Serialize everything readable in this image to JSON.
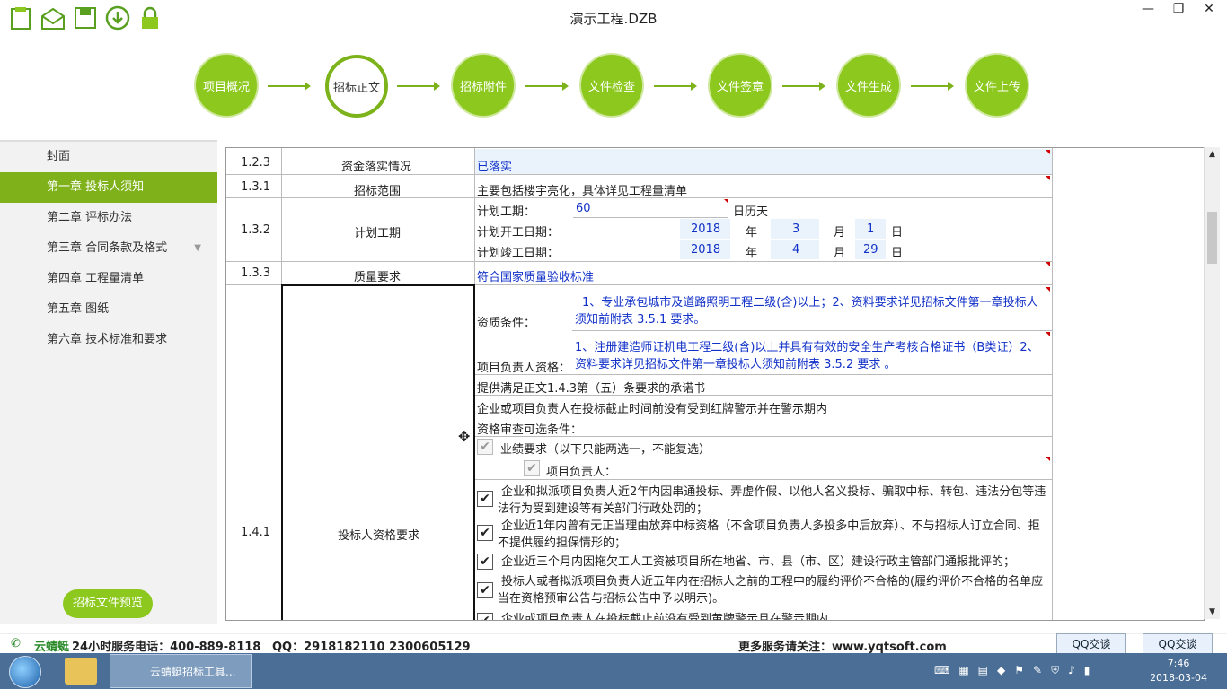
{
  "window": {
    "title": "演示工程.DZB"
  },
  "steps": [
    "项目概况",
    "招标正文",
    "招标附件",
    "文件检查",
    "文件签章",
    "文件生成",
    "文件上传"
  ],
  "sidebar": {
    "items": [
      "封面",
      "第一章 投标人须知",
      "第二章 评标办法",
      "第三章 合同条款及格式",
      "第四章 工程量清单",
      "第五章 图纸",
      "第六章 技术标准和要求"
    ],
    "preview_button": "招标文件预览"
  },
  "table": {
    "r123": {
      "num": "1.2.3",
      "name": "资金落实情况",
      "value": "已落实"
    },
    "r131": {
      "num": "1.3.1",
      "name": "招标范围",
      "value": "主要包括楼宇亮化，具体详见工程量清单"
    },
    "r132": {
      "num": "1.3.2",
      "name": "计划工期",
      "duration_label": "计划工期：",
      "duration": "60",
      "duration_unit": "日历天",
      "start_label": "计划开工日期：",
      "start_year": "2018",
      "start_month": "3",
      "start_day": "1",
      "end_label": "计划竣工日期：",
      "end_year": "2018",
      "end_month": "4",
      "end_day": "29",
      "year_char": "年",
      "month_char": "月",
      "day_char": "日"
    },
    "r133": {
      "num": "1.3.3",
      "name": "质量要求",
      "value": "符合国家质量验收标准"
    },
    "r141": {
      "num": "1.4.1",
      "name": "投标人资格要求",
      "qual_label": "资质条件：",
      "qual_value": "1、专业承包城市及道路照明工程二级(含)以上；2、资料要求详见招标文件第一章投标人须知前附表 3.5.1 要求。",
      "pm_label": "项目负责人资格：",
      "pm_value": "1、注册建造师证机电工程二级(含)以上并具有有效的安全生产考核合格证书（B类证）2、资料要求详见招标文件第一章投标人须知前附表 3.5.2 要求 。",
      "line1": "提供满足正文1.4.3第（五）条要求的承诺书",
      "line2": "企业或项目负责人在投标截止时间前没有受到红牌警示并在警示期内",
      "optional_label": "资格审查可选条件：",
      "perf_label": "业绩要求（以下只能两选一，不能复选）",
      "pm_perf_label": "项目负责人：",
      "conditions": [
        "企业和拟派项目负责人近2年内因串通投标、弄虚作假、以他人名义投标、骗取中标、转包、违法分包等违法行为受到建设等有关部门行政处罚的；",
        "企业近1年内曾有无正当理由放弃中标资格（不含项目负责人多投多中后放弃）、不与招标人订立合同、拒不提供履约担保情形的；",
        "企业近三个月内因拖欠工人工资被项目所在地省、市、县（市、区）建设行政主管部门通报批评的；",
        "投标人或者拟派项目负责人近五年内在招标人之前的工程中的履约评价不合格的(履约评价不合格的名单应当在资格预审公告与招标公告中予以明示)。",
        "企业或项目负责人在投标截止前没有受到黄牌警示且在警示期内"
      ],
      "check_mark": "✔"
    }
  },
  "infobar": {
    "company": "云蜻蜓",
    "hotline": "24小时服务电话：400-889-8118",
    "qq": "QQ：2918182110  2300605129",
    "more": "更多服务请关注：www.yqtsoft.com",
    "qq_btn1": "QQ交谈",
    "qq_btn2": "QQ交谈"
  },
  "taskbar": {
    "app_label": "云蜻蜓招标工具...",
    "time": "7:46",
    "date": "2018-03-04"
  },
  "colors": {
    "accent": "#8cc81e",
    "active": "#7fb21a",
    "link_blue": "#1030c8",
    "taskbar": "#4a6e96"
  }
}
